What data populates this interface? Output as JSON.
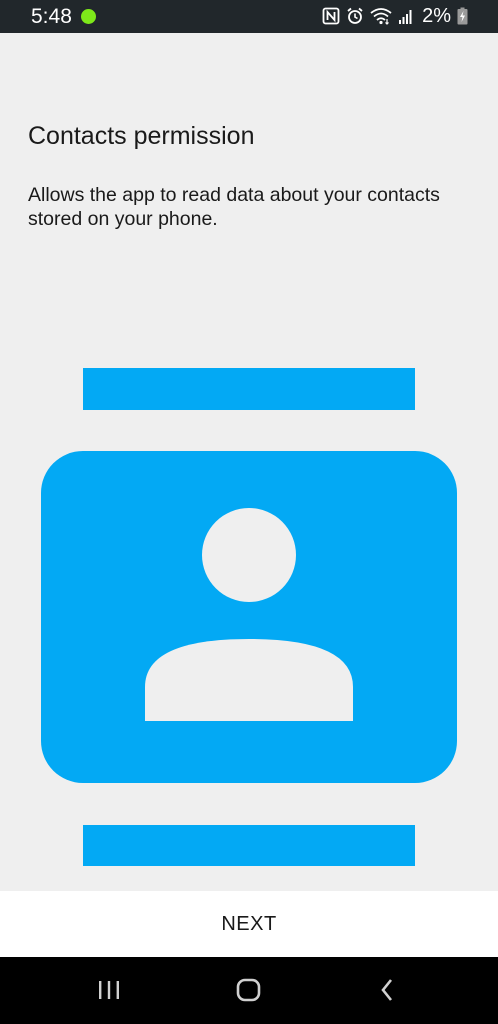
{
  "status_bar": {
    "time": "5:48",
    "battery": "2%",
    "icons": [
      "nfc-icon",
      "alarm-icon",
      "wifi-icon",
      "signal-icon",
      "battery-charging-icon"
    ],
    "dot_color": "#7ee81a"
  },
  "content": {
    "title": "Contacts permission",
    "description": "Allows the app to read data about your contacts stored on your phone."
  },
  "illustration": {
    "icon": "contact-card-icon",
    "color": "#03a9f4"
  },
  "footer": {
    "next_label": "NEXT"
  },
  "nav_bar": {
    "buttons": [
      "recent-apps",
      "home",
      "back"
    ]
  }
}
